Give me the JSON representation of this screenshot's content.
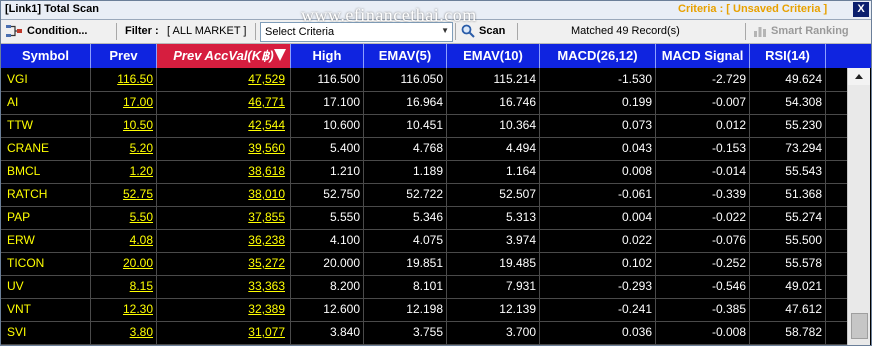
{
  "window": {
    "title": "[Link1] Total Scan",
    "criteria_status": "Criteria : [ Unsaved Criteria ]",
    "close_label": "X"
  },
  "watermark": "www.efinancethai.com",
  "toolbar": {
    "condition_label": "Condition...",
    "filter_label": "Filter :",
    "filter_value": "[ ALL MARKET ]",
    "criteria_select": "Select Criteria",
    "scan_label": "Scan",
    "matched_text": "Matched 49 Record(s)",
    "smart_ranking_label": "Smart Ranking"
  },
  "columns": {
    "symbol": "Symbol",
    "prev": "Prev",
    "prev_acc_val": "Prev AccVal(K฿)",
    "high": "High",
    "emav5": "EMAV(5)",
    "emav10": "EMAV(10)",
    "macd": "MACD(26,12)",
    "macd_signal": "MACD Signal",
    "rsi": "RSI(14)"
  },
  "rows": [
    {
      "symbol": "VGI",
      "prev": "116.50",
      "acc": "47,529",
      "high": "116.500",
      "e5": "116.050",
      "e10": "115.214",
      "macd": "-1.530",
      "sig": "-2.729",
      "rsi": "49.624"
    },
    {
      "symbol": "AI",
      "prev": "17.00",
      "acc": "46,771",
      "high": "17.100",
      "e5": "16.964",
      "e10": "16.746",
      "macd": "0.199",
      "sig": "-0.007",
      "rsi": "54.308"
    },
    {
      "symbol": "TTW",
      "prev": "10.50",
      "acc": "42,544",
      "high": "10.600",
      "e5": "10.451",
      "e10": "10.364",
      "macd": "0.073",
      "sig": "0.012",
      "rsi": "55.230"
    },
    {
      "symbol": "CRANE",
      "prev": "5.20",
      "acc": "39,560",
      "high": "5.400",
      "e5": "4.768",
      "e10": "4.494",
      "macd": "0.043",
      "sig": "-0.153",
      "rsi": "73.294"
    },
    {
      "symbol": "BMCL",
      "prev": "1.20",
      "acc": "38,618",
      "high": "1.210",
      "e5": "1.189",
      "e10": "1.164",
      "macd": "0.008",
      "sig": "-0.014",
      "rsi": "55.543"
    },
    {
      "symbol": "RATCH",
      "prev": "52.75",
      "acc": "38,010",
      "high": "52.750",
      "e5": "52.722",
      "e10": "52.507",
      "macd": "-0.061",
      "sig": "-0.339",
      "rsi": "51.368"
    },
    {
      "symbol": "PAP",
      "prev": "5.50",
      "acc": "37,855",
      "high": "5.550",
      "e5": "5.346",
      "e10": "5.313",
      "macd": "0.004",
      "sig": "-0.022",
      "rsi": "55.274"
    },
    {
      "symbol": "ERW",
      "prev": "4.08",
      "acc": "36,238",
      "high": "4.100",
      "e5": "4.075",
      "e10": "3.974",
      "macd": "0.022",
      "sig": "-0.076",
      "rsi": "55.500"
    },
    {
      "symbol": "TICON",
      "prev": "20.00",
      "acc": "35,272",
      "high": "20.000",
      "e5": "19.851",
      "e10": "19.485",
      "macd": "0.102",
      "sig": "-0.252",
      "rsi": "55.578"
    },
    {
      "symbol": "UV",
      "prev": "8.15",
      "acc": "33,363",
      "high": "8.200",
      "e5": "8.101",
      "e10": "7.931",
      "macd": "-0.293",
      "sig": "-0.546",
      "rsi": "49.021"
    },
    {
      "symbol": "VNT",
      "prev": "12.30",
      "acc": "32,389",
      "high": "12.600",
      "e5": "12.198",
      "e10": "12.139",
      "macd": "-0.241",
      "sig": "-0.385",
      "rsi": "47.612"
    },
    {
      "symbol": "SVI",
      "prev": "3.80",
      "acc": "31,077",
      "high": "3.840",
      "e5": "3.755",
      "e10": "3.700",
      "macd": "0.036",
      "sig": "-0.008",
      "rsi": "58.782"
    }
  ],
  "colors": {
    "header_bg": "#0f24e0",
    "sorted_header_bg": "#d61e3f",
    "symbol_text": "#ffff00",
    "grid_bg": "#000000"
  }
}
